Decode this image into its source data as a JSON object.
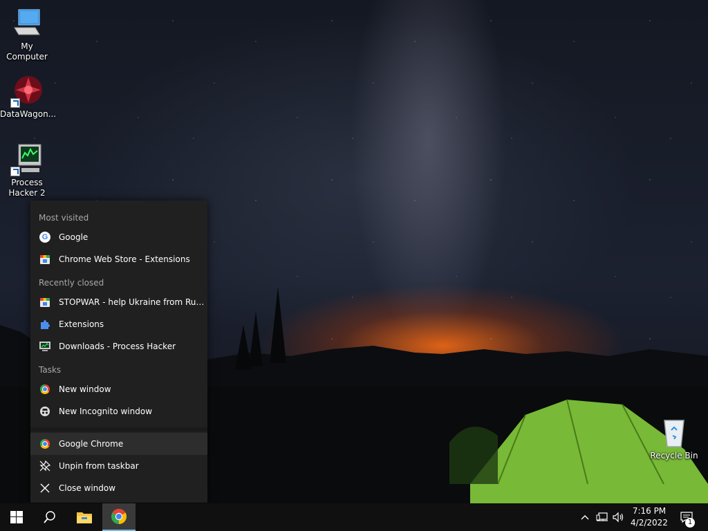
{
  "desktop": {
    "icons": [
      {
        "label": "My Computer"
      },
      {
        "label": "DataWagon..."
      },
      {
        "label": "Process Hacker 2"
      },
      {
        "label": "Recycle Bin"
      }
    ]
  },
  "jumplist": {
    "most_visited_header": "Most visited",
    "most_visited": [
      {
        "label": "Google",
        "icon": "google-icon"
      },
      {
        "label": "Chrome Web Store - Extensions",
        "icon": "chrome-web-store-icon"
      }
    ],
    "recently_closed_header": "Recently closed",
    "recently_closed": [
      {
        "label": "STOPWAR - help Ukraine from Russian...",
        "icon": "chrome-web-store-icon"
      },
      {
        "label": "Extensions",
        "icon": "puzzle-icon"
      },
      {
        "label": "Downloads - Process Hacker",
        "icon": "process-hacker-icon"
      }
    ],
    "tasks_header": "Tasks",
    "tasks": [
      {
        "label": "New window",
        "icon": "chrome-icon"
      },
      {
        "label": "New Incognito window",
        "icon": "incognito-icon"
      }
    ],
    "app_actions": [
      {
        "label": "Google Chrome",
        "icon": "chrome-icon"
      },
      {
        "label": "Unpin from taskbar",
        "icon": "unpin-icon"
      },
      {
        "label": "Close window",
        "icon": "close-icon"
      }
    ]
  },
  "taskbar": {
    "pinned": [
      "start-icon",
      "search-icon",
      "file-explorer-icon",
      "chrome-icon"
    ],
    "active_app": "Google Chrome",
    "clock": {
      "time": "7:16 PM",
      "date": "4/2/2022"
    },
    "notification_count": "1"
  },
  "colors": {
    "jumplist_bg": "#202020",
    "taskbar_bg": "#101010",
    "active_indicator": "#76b9ed"
  }
}
